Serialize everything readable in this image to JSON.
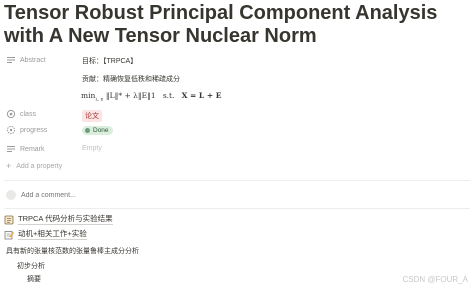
{
  "page": {
    "title": "Tensor Robust Principal Component Analysis with A New Tensor Nuclear Norm"
  },
  "properties": {
    "abstract": {
      "label": "Abstract",
      "icon": "lines-icon",
      "line1": "目标：【TRPCA】",
      "line2": "贡献：精确恢复低秩和稀疏成分",
      "formula": {
        "operator": "min",
        "sub": "L, E",
        "objective": "‖L‖* + λ‖E‖1",
        "st": "s.t.",
        "constraint": "X = L + E"
      }
    },
    "class": {
      "label": "class",
      "icon": "target-icon",
      "value": "论文"
    },
    "progress": {
      "label": "progress",
      "icon": "sparkle-icon",
      "value": "Done"
    },
    "remark": {
      "label": "Remark",
      "icon": "lines-icon",
      "value": "Empty"
    }
  },
  "add_property": {
    "label": "Add a property",
    "icon": "plus-icon"
  },
  "comment": {
    "placeholder": "Add a comment..."
  },
  "content": {
    "links": [
      {
        "icon": "notebook-icon",
        "text": "TRPCA 代码分析与实验结果"
      },
      {
        "icon": "memo-icon",
        "text": "动机+相关工作+实验"
      }
    ],
    "paragraph": "具有新的张量核范数的张量鲁棒主成分分析",
    "sub1": "初步分析",
    "sub2": "摘要"
  },
  "watermark": "CSDN @FOUR_A",
  "colors": {
    "text": "#37352f",
    "muted": "#9b9a97",
    "tag_red_bg": "#fbe4e4",
    "tag_green_bg": "#dbeddb",
    "tag_green_dot": "#6c9b7d"
  }
}
